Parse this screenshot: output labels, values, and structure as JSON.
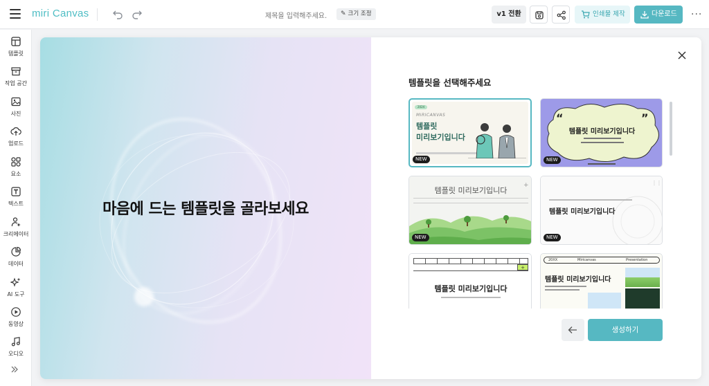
{
  "app": {
    "logo_text": "miri Canvas",
    "document_title_placeholder": "제목을 입력해주세요.",
    "resize_label": "크기 조정"
  },
  "toolbar": {
    "v1_label": "v1 전환",
    "print_label": "인쇄물 제작",
    "download_label": "다운로드",
    "more_label": "···"
  },
  "sidebar": {
    "items": [
      {
        "label": "템플릿",
        "icon": "template-icon"
      },
      {
        "label": "작업 공간",
        "icon": "archive-icon"
      },
      {
        "label": "사진",
        "icon": "image-icon"
      },
      {
        "label": "업로드",
        "icon": "upload-icon"
      },
      {
        "label": "요소",
        "icon": "shapes-icon"
      },
      {
        "label": "텍스트",
        "icon": "text-icon"
      },
      {
        "label": "크리에이터",
        "icon": "creator-icon"
      },
      {
        "label": "데이터",
        "icon": "chart-icon"
      },
      {
        "label": "AI 도구",
        "icon": "sparkle-icon"
      },
      {
        "label": "동영상",
        "icon": "play-icon"
      },
      {
        "label": "오디오",
        "icon": "music-icon"
      }
    ]
  },
  "modal": {
    "hero_title": "마음에 드는 템플릿을 골라보세요",
    "panel_title": "템플릿을 선택해주세요",
    "create_label": "생성하기",
    "templates": [
      {
        "title_line1": "템플릿",
        "title_line2": "미리보기입니다",
        "brand": "MIRICANVAS",
        "pill": "2024",
        "badge": "NEW",
        "selected": true
      },
      {
        "title": "템플릿 미리보기입니다",
        "quote_open": "“",
        "quote_close": "”",
        "badge": "NEW"
      },
      {
        "title": "템플릿 미리보기입니다",
        "badge": "NEW"
      },
      {
        "title": "템플릿 미리보기입니다",
        "badge": "NEW"
      },
      {
        "title": "템플릿 미리보기입니다"
      },
      {
        "title": "템플릿 미리보기입니다",
        "header_left": "20XX",
        "header_mid": "Miricanvas",
        "header_right": "Presentation"
      }
    ]
  },
  "colors": {
    "accent": "#56b8c2",
    "accent_light": "#e7f6f8",
    "logo": "#4ebdc4"
  }
}
